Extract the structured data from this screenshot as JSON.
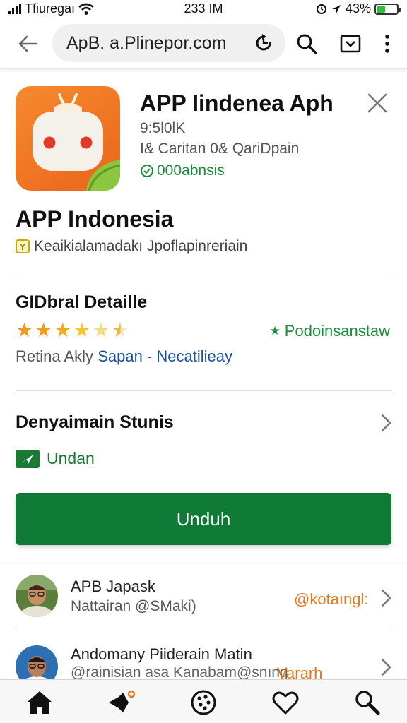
{
  "status_bar": {
    "carrier": "Tfiuregaı",
    "time": "233 IM",
    "battery_text": "43%",
    "battery_level": 0.43
  },
  "browser": {
    "url": "ApB. a.Plinepor.com"
  },
  "app_header": {
    "title": "APP  Iindenea Aph",
    "size": "9:5l0lK",
    "category": "I& Caritan 0& QariDpain",
    "verified_text": "000abnsis"
  },
  "app": {
    "name": "APP Indonesia",
    "developer_badge": "Y",
    "developer_line": "Keaikialamadakı Jpoflapinreriain"
  },
  "details": {
    "title": "GIDbral Detaille",
    "rating": 4.5,
    "rating_tag": "Podoinsanstaw",
    "line_prefix": "Retina Akly",
    "line_link": "Sapan - Necatilieay"
  },
  "permissions": {
    "title": "Denyaimain Stunis",
    "status": "Undan"
  },
  "download_button": "Unduh",
  "reviews": [
    {
      "name": "APB Japask",
      "sub": "Nattairan @SMaki)",
      "tag": "@kotaıngl:"
    },
    {
      "name": "Andomany Piiderain Matin",
      "sub": "@rainisian asa Kanabam@snıng",
      "tag": "Vararh"
    }
  ],
  "icons": {
    "back": "arrow-left-icon",
    "reload": "reload-icon",
    "search": "search-icon",
    "tab": "tab-down-icon",
    "menu": "more-vert-icon",
    "close": "close-icon",
    "home": "home-icon",
    "games": "rocket-icon",
    "apps": "palette-icon",
    "wishlist": "heart-icon",
    "search_nav": "search-icon"
  },
  "colors": {
    "accent_green": "#0e7a36",
    "app_icon_orange": "#ef7524",
    "link_blue": "#1d4f9c",
    "review_tag_orange": "#e8761a"
  }
}
